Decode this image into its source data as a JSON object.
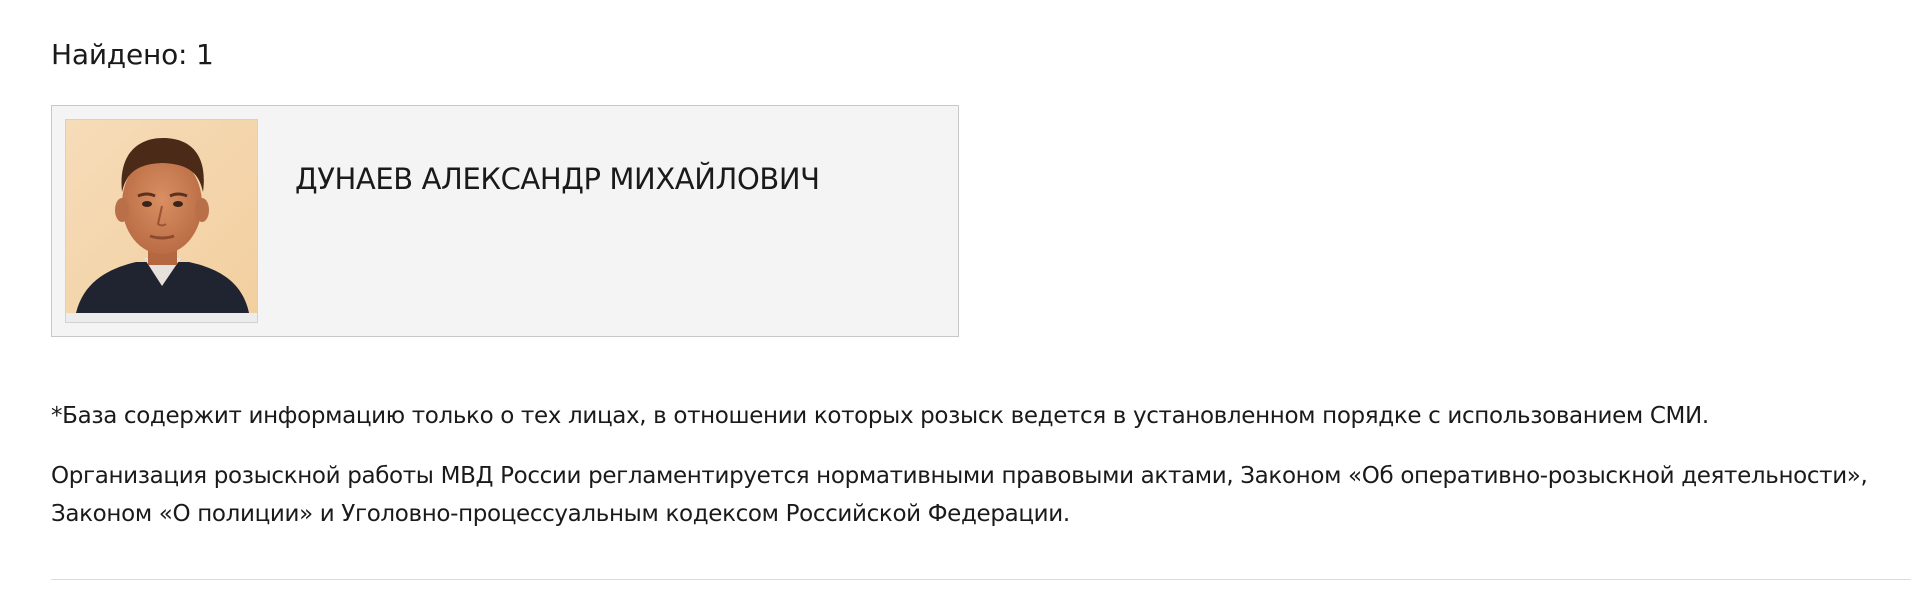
{
  "results": {
    "found_label": "Найдено: 1"
  },
  "card": {
    "photo_alt": "ДУНАЕВ АЛЕКСАНДР МИХАЙЛОВИЧ",
    "name": "ДУНАЕВ АЛЕКСАНДР МИХАЙЛОВИЧ"
  },
  "footer": {
    "note": "*База содержит информацию только о тех лицах, в отношении которых розыск ведется в установленном порядке с использованием СМИ.",
    "legal_line1": "Организация розыскной работы МВД России регламентируется нормативными правовыми актами, Законом «Об оперативно-розыскной деятельности»,",
    "legal_line2": "Законом «О полиции» и Уголовно-процессуальным кодексом Российской Федерации."
  },
  "colors": {
    "card_background": "#f4f4f4",
    "card_border": "#c8c8c8",
    "text": "#1a1a1a",
    "divider": "#dcdcdc"
  }
}
